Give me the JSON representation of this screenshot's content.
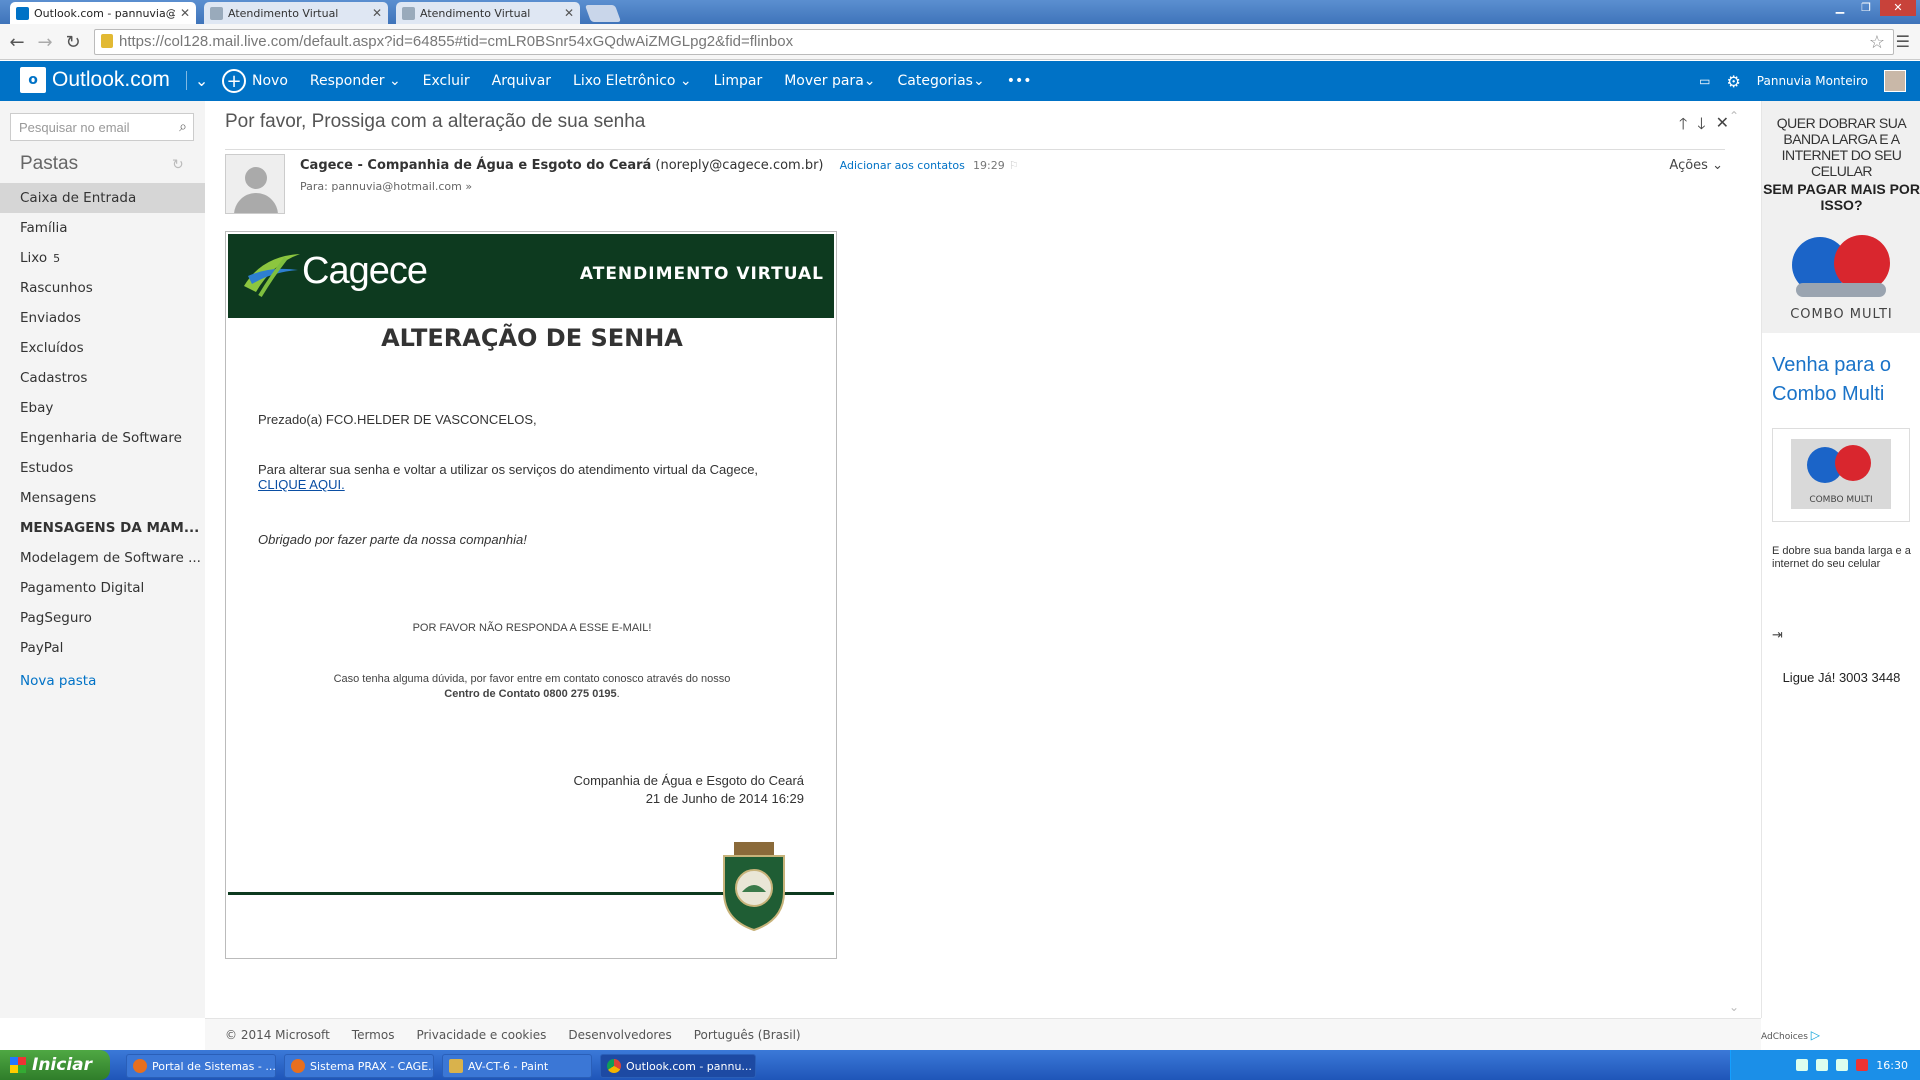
{
  "browser": {
    "tabs": [
      {
        "title": "Outlook.com - pannuvia@hot",
        "active": true
      },
      {
        "title": "Atendimento Virtual",
        "active": false
      },
      {
        "title": "Atendimento Virtual",
        "active": false
      }
    ],
    "url": "https://col128.mail.live.com/default.aspx?id=64855#tid=cmLR0BSnr54xGQdwAiZMGLpg2&fid=flinbox"
  },
  "header": {
    "brand": "Outlook.com",
    "commands": {
      "novo": "Novo",
      "responder": "Responder",
      "excluir": "Excluir",
      "arquivar": "Arquivar",
      "lixo": "Lixo Eletrônico",
      "limpar": "Limpar",
      "mover": "Mover para",
      "categorias": "Categorias",
      "more": "•••"
    },
    "user": "Pannuvia Monteiro"
  },
  "sidebar": {
    "search_placeholder": "Pesquisar no email",
    "folders_title": "Pastas",
    "folders": [
      {
        "label": "Caixa de Entrada",
        "count": ""
      },
      {
        "label": "Família",
        "count": ""
      },
      {
        "label": "Lixo",
        "count": "5"
      },
      {
        "label": "Rascunhos",
        "count": ""
      },
      {
        "label": "Enviados",
        "count": ""
      },
      {
        "label": "Excluídos",
        "count": ""
      },
      {
        "label": "Cadastros",
        "count": ""
      },
      {
        "label": "Ebay",
        "count": ""
      },
      {
        "label": "Engenharia de Software",
        "count": ""
      },
      {
        "label": "Estudos",
        "count": ""
      },
      {
        "label": "Mensagens",
        "count": ""
      },
      {
        "label": "MENSAGENS DA MAM...",
        "count": ""
      },
      {
        "label": "Modelagem de Software ...",
        "count": ""
      },
      {
        "label": "Pagamento Digital",
        "count": ""
      },
      {
        "label": "PagSeguro",
        "count": ""
      },
      {
        "label": "PayPal",
        "count": ""
      }
    ],
    "new_folder": "Nova pasta"
  },
  "message": {
    "subject": "Por favor, Prossiga com a alteração de sua senha",
    "sender_name": "Cagece - Companhia de Água e Esgoto do Ceará",
    "sender_email": "(noreply@cagece.com.br)",
    "add_contact": "Adicionar aos contatos",
    "time": "19:29",
    "to": "Para: pannuvia@hotmail.com",
    "actions": "Ações"
  },
  "email": {
    "logo_text": "Cagece",
    "banner_title": "ATENDIMENTO VIRTUAL",
    "heading": "ALTERAÇÃO DE SENHA",
    "greeting": "Prezado(a) FCO.HELDER DE VASCONCELOS,",
    "paragraph": "Para alterar sua senha e voltar a utilizar os serviços do atendimento virtual da Cagece,",
    "link": "CLIQUE AQUI.",
    "thanks": "Obrigado por fazer parte da nossa companhia!",
    "noreply": "POR FAVOR NÃO RESPONDA A ESSE E-MAIL!",
    "doubt": "Caso tenha alguma dúvida, por favor entre em contato conosco através do nosso",
    "contact_center": "Centro de Contato 0800 275 0195",
    "signature_company": "Companhia de Água e Esgoto do Ceará",
    "signature_date": "21 de Junho de 2014 16:29"
  },
  "ad": {
    "top_line": "QUER DOBRAR SUA BANDA LARGA E A INTERNET DO SEU CELULAR",
    "top_bold": "SEM PAGAR MAIS POR ISSO?",
    "combo": "COMBO MULTI",
    "headline": "Venha para o Combo Multi",
    "thumb_caption": "COMBO MULTI",
    "body": "E dobre sua banda larga e a internet do seu celular",
    "call": "Ligue Já! 3003 3448",
    "adchoices": "AdChoices"
  },
  "footer": {
    "copyright": "© 2014 Microsoft",
    "termos": "Termos",
    "privacidade": "Privacidade e cookies",
    "desenvolvedores": "Desenvolvedores",
    "idioma": "Português (Brasil)"
  },
  "taskbar": {
    "start": "Iniciar",
    "tasks": [
      {
        "label": "Portal de Sistemas - ..."
      },
      {
        "label": "Sistema PRAX - CAGE..."
      },
      {
        "label": "AV-CT-6 - Paint"
      },
      {
        "label": "Outlook.com - pannu..."
      }
    ],
    "clock": "16:30"
  },
  "colors": {
    "outlook_blue": "#0072c6",
    "cagece_green": "#0d3a1f",
    "link_blue": "#0a4ea3"
  }
}
